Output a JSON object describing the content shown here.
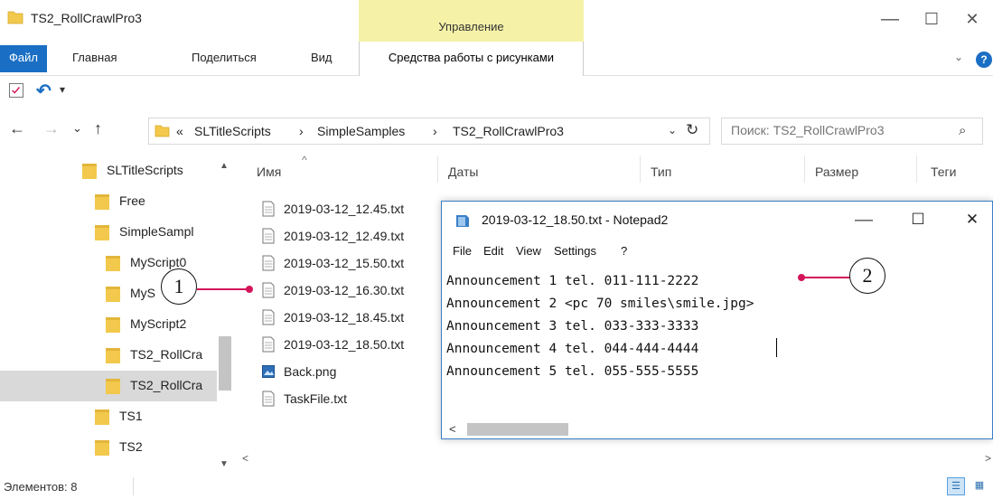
{
  "window": {
    "title": "TS2_RollCrawlPro3",
    "manage_label": "Управление",
    "minimize": "—",
    "maximize": "☐",
    "close": "✕"
  },
  "ribbon": {
    "tabs": [
      "Файл",
      "Главная",
      "Поделиться",
      "Вид"
    ],
    "context_tab": "Средства работы с рисунками",
    "collapse": "⌄",
    "help": "?"
  },
  "qat": {
    "undo": "↶",
    "dropdown": "▾"
  },
  "nav": {
    "back": "←",
    "forward": "→",
    "recent": "⌄",
    "up": "↑",
    "breadcrumb": [
      "«",
      "SLTitleScripts",
      "›",
      "SimpleSamples",
      "›",
      "TS2_RollCrawlPro3"
    ],
    "address_dropdown": "⌄",
    "refresh": "↻",
    "search_placeholder": "Поиск: TS2_RollCrawlPro3",
    "search_icon": "⌕"
  },
  "tree": [
    "SLTitleScripts",
    "Free",
    "SimpleSampl",
    "MyScript0",
    "MyS",
    "MyScript2",
    "TS2_RollCra",
    "TS2_RollCra",
    "TS1",
    "TS2"
  ],
  "tree_scroll": {
    "up": "▲",
    "down": "▼"
  },
  "columns": [
    "Имя",
    "Даты",
    "Тип",
    "Размер",
    "Теги"
  ],
  "sort_indicator": "^",
  "files": [
    "2019-03-12_12.45.txt",
    "2019-03-12_12.49.txt",
    "2019-03-12_15.50.txt",
    "2019-03-12_16.30.txt",
    "2019-03-12_18.45.txt",
    "2019-03-12_18.50.txt",
    "Back.png",
    "TaskFile.txt"
  ],
  "list_scroll": {
    "left": "<",
    "right": ">"
  },
  "status": {
    "items": "Элементов: 8",
    "view_details": "☰",
    "view_tiles": "▦"
  },
  "notepad": {
    "title": "2019-03-12_18.50.txt - Notepad2",
    "minimize": "—",
    "maximize": "☐",
    "close": "✕",
    "menu": [
      "File",
      "Edit",
      "View",
      "Settings",
      "?"
    ],
    "lines": [
      "Announcement 1 tel. 011-111-2222",
      "Announcement 2 <pc 70 smiles\\smile.jpg>",
      "Announcement 3 tel. 033-333-3333",
      "Announcement 4 tel. 044-444-4444",
      "Announcement 5 tel. 055-555-5555"
    ],
    "scroll_left": "<"
  },
  "callouts": [
    "1",
    "2"
  ],
  "colors": {
    "accent": "#1a6fc4",
    "manage_highlight": "#f5f2a8",
    "callout_line": "#d4145a",
    "folder": "#f2c94c",
    "selection": "#d9d9d9"
  }
}
